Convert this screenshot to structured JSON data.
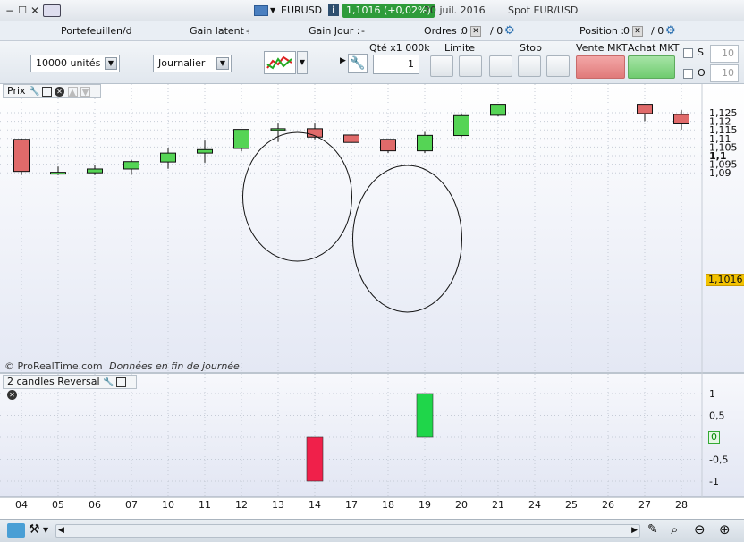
{
  "titlebar": {
    "symbol": "EURUSD",
    "price_badge": "1,1016 (+0,02%)",
    "date_info": "20 juil. 2016",
    "instrument": "Spot EUR/USD"
  },
  "info": {
    "portfolio_label": "Portefeuille :",
    "portfolio_value": "n/d",
    "latent_label": "Gain latent :",
    "latent_value": "-",
    "day_label": "Gain Jour :",
    "day_value": "-",
    "orders_label": "Ordres :",
    "orders_value": "0",
    "orders_slash": "/ 0",
    "position_label": "Position :",
    "position_value": "0",
    "position_slash": "/ 0"
  },
  "orderbar": {
    "size_select": "10000 unités",
    "period_select": "Journalier",
    "qty_label": "Qté x1 000k",
    "qty_value": "1",
    "limit_label": "Limite",
    "stop_label": "Stop",
    "sell_label": "Vente MKT",
    "buy_label": "Achat MKT",
    "s_label": "S",
    "o_label": "O",
    "s_value": "10",
    "o_value": "10"
  },
  "price_panel": {
    "title": "Prix",
    "watermark": "© ProRealTime.com",
    "watermark_note": "Données en fin de journée",
    "last_price": "1,1016",
    "y_ticks": [
      "1,125",
      "1,12",
      "1,115",
      "1,11",
      "1,105",
      "1,1",
      "1,095",
      "1,09"
    ],
    "y_tick_values": [
      1.125,
      1.12,
      1.115,
      1.11,
      1.105,
      1.1,
      1.095,
      1.09
    ]
  },
  "indicator_panel": {
    "title": "2 candles Reversal",
    "y_ticks": [
      "1",
      "0,5",
      "0",
      "-0,5",
      "-1"
    ],
    "y_tick_values": [
      1,
      0.5,
      0,
      -0.5,
      -1
    ],
    "last_value": "0"
  },
  "x_labels": [
    "04",
    "05",
    "06",
    "07",
    "10",
    "11",
    "12",
    "13",
    "14",
    "17",
    "18",
    "19",
    "20",
    "21",
    "24",
    "25",
    "26",
    "27",
    "28"
  ],
  "chart_data": {
    "type": "candlestick",
    "ylim": [
      1.0885,
      1.1285
    ],
    "candles": [
      {
        "x": "04",
        "open": 1.1095,
        "high": 1.1099,
        "low": 1.0887,
        "close": 1.0908,
        "color": "red"
      },
      {
        "x": "05",
        "open": 1.0895,
        "high": 1.0936,
        "low": 1.0887,
        "close": 1.0903,
        "color": "green"
      },
      {
        "x": "06",
        "open": 1.09,
        "high": 1.0945,
        "low": 1.0887,
        "close": 1.0922,
        "color": "green"
      },
      {
        "x": "07",
        "open": 1.0922,
        "high": 1.0975,
        "low": 1.0888,
        "close": 1.0965,
        "color": "green"
      },
      {
        "x": "10",
        "open": 1.0963,
        "high": 1.1043,
        "low": 1.0923,
        "close": 1.1015,
        "color": "green"
      },
      {
        "x": "11",
        "open": 1.1015,
        "high": 1.1088,
        "low": 1.0959,
        "close": 1.1035,
        "color": "green"
      },
      {
        "x": "12",
        "open": 1.1042,
        "high": 1.112,
        "low": 1.1025,
        "close": 1.1153,
        "color": "green"
      },
      {
        "x": "13",
        "open": 1.1153,
        "high": 1.1187,
        "low": 1.108,
        "close": 1.1157,
        "color": "green"
      },
      {
        "x": "14",
        "open": 1.1157,
        "high": 1.1187,
        "low": 1.1095,
        "close": 1.1108,
        "color": "red"
      },
      {
        "x": "17",
        "open": 1.112,
        "high": 1.112,
        "low": 1.1075,
        "close": 1.1077,
        "color": "red"
      },
      {
        "x": "18",
        "open": 1.1095,
        "high": 1.1095,
        "low": 1.1015,
        "close": 1.1028,
        "color": "red"
      },
      {
        "x": "19",
        "open": 1.1028,
        "high": 1.1138,
        "low": 1.1015,
        "close": 1.1118,
        "color": "green"
      },
      {
        "x": "20",
        "open": 1.1117,
        "high": 1.1242,
        "low": 1.1107,
        "close": 1.1233,
        "color": "green"
      },
      {
        "x": "21",
        "open": 1.1235,
        "high": 1.1299,
        "low": 1.1229,
        "close": 1.1299,
        "color": "green"
      },
      {
        "x": "27",
        "open": 1.1299,
        "high": 1.1299,
        "low": 1.1201,
        "close": 1.1245,
        "color": "red"
      },
      {
        "x": "28",
        "open": 1.124,
        "high": 1.1265,
        "low": 1.1152,
        "close": 1.1185,
        "color": "red"
      }
    ],
    "indicator": {
      "name": "2 candles Reversal",
      "bars": [
        {
          "x": "14",
          "value": -1,
          "color": "red"
        },
        {
          "x": "19",
          "value": 1,
          "color": "green"
        }
      ]
    },
    "annotations": [
      {
        "type": "ellipse",
        "around": [
          "13",
          "14"
        ]
      },
      {
        "type": "ellipse",
        "around": [
          "18",
          "19"
        ]
      }
    ]
  }
}
